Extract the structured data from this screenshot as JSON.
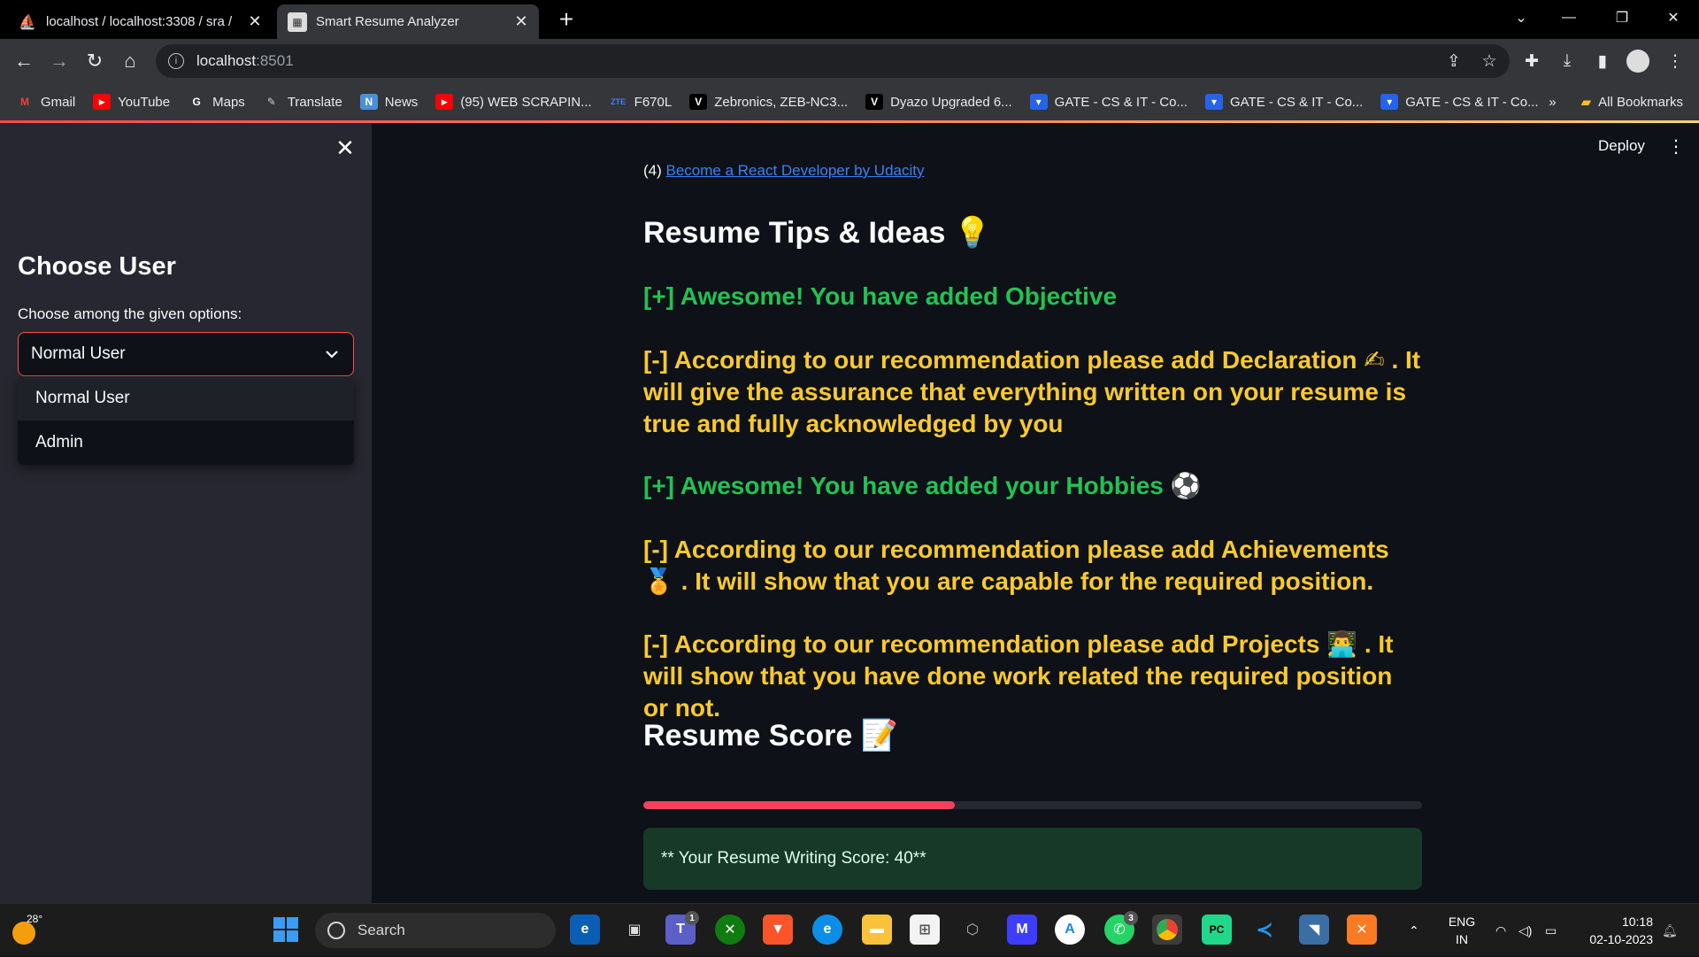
{
  "browser": {
    "tabs": [
      {
        "title": "localhost / localhost:3308 / sra /",
        "active": false
      },
      {
        "title": "Smart Resume Analyzer",
        "active": true
      }
    ],
    "address": {
      "host": "localhost",
      "port": ":8501"
    },
    "bookmarks": [
      {
        "label": "Gmail",
        "icon": "gmail-icon"
      },
      {
        "label": "YouTube",
        "icon": "youtube-icon"
      },
      {
        "label": "Maps",
        "icon": "google-icon"
      },
      {
        "label": "Translate",
        "icon": "translate-icon"
      },
      {
        "label": "News",
        "icon": "news-icon"
      },
      {
        "label": "(95) WEB SCRAPIN...",
        "icon": "youtube-icon"
      },
      {
        "label": "F670L",
        "icon": "zte-icon"
      },
      {
        "label": "Zebronics, ZEB-NC3...",
        "icon": "v-icon"
      },
      {
        "label": "Dyazo Upgraded 6...",
        "icon": "v-icon"
      },
      {
        "label": "GATE - CS & IT - Co...",
        "icon": "gate-icon"
      },
      {
        "label": "GATE - CS & IT - Co...",
        "icon": "gate-icon"
      },
      {
        "label": "GATE - CS & IT - Co...",
        "icon": "gate-icon"
      }
    ],
    "bookmarks_more": "»",
    "all_bookmarks": "All Bookmarks"
  },
  "app": {
    "deploy_label": "Deploy",
    "sidebar": {
      "title": "Choose User",
      "select_label": "Choose among the given options:",
      "selected": "Normal User",
      "options": [
        "Normal User",
        "Admin"
      ]
    },
    "main": {
      "cut_link_prefix": "(4) ",
      "cut_link_text": "Become a React Developer by Udacity",
      "tips_heading": "Resume Tips & Ideas 💡",
      "tips": [
        {
          "kind": "good",
          "text": "[+] Awesome! You have added Objective"
        },
        {
          "kind": "warn",
          "text": "[-] According to our recommendation please add Declaration ✍ . It will give the assurance that everything written on your resume is true and fully acknowledged by you"
        },
        {
          "kind": "good",
          "text": "[+] Awesome! You have added your Hobbies ⚽"
        },
        {
          "kind": "warn",
          "text": "[-] According to our recommendation please add Achievements 🏅 . It will show that you are capable for the required position."
        },
        {
          "kind": "warn",
          "text": "[-] According to our recommendation please add Projects 👨‍💻 . It will show that you have done work related the required position or not."
        }
      ],
      "score_heading": "Resume Score 📝",
      "score_progress": 40,
      "score_message": "** Your Resume Writing Score: 40**"
    }
  },
  "taskbar": {
    "weather_temp": "28°",
    "search_placeholder": "Search",
    "lang_line1": "ENG",
    "lang_line2": "IN",
    "time": "10:18",
    "date": "02-10-2023",
    "badges": {
      "teams": "1",
      "whatsapp": "3"
    }
  },
  "colors": {
    "accent": "#ff4b4b",
    "good": "#21c354",
    "warn": "#faca2b",
    "progress": "#f2415a",
    "success_bg": "#173928"
  }
}
